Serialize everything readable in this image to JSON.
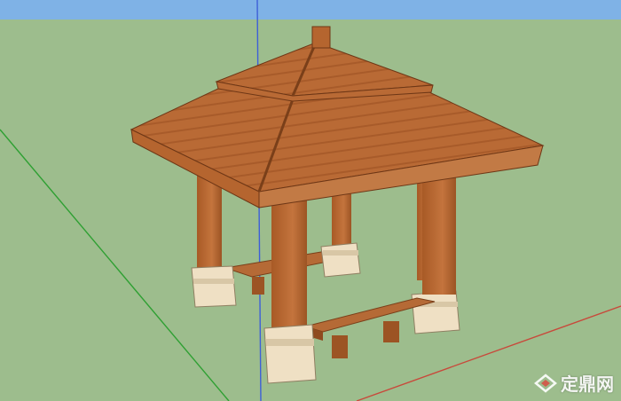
{
  "scene": {
    "subject": "wooden-pavilion-3d-model",
    "colors": {
      "sky": "#7fb2e6",
      "ground": "#9dbd8d",
      "wood": "#b5652f",
      "wood_dark": "#8a4a20",
      "roof_light": "#c27a45",
      "plinth": "#efe0c4",
      "axis_blue": "#3d5fd8",
      "axis_green": "#2fa033",
      "axis_red": "#c8493b"
    }
  },
  "watermark": {
    "text": "定鼎网",
    "icon": "dingding-logo-icon"
  }
}
